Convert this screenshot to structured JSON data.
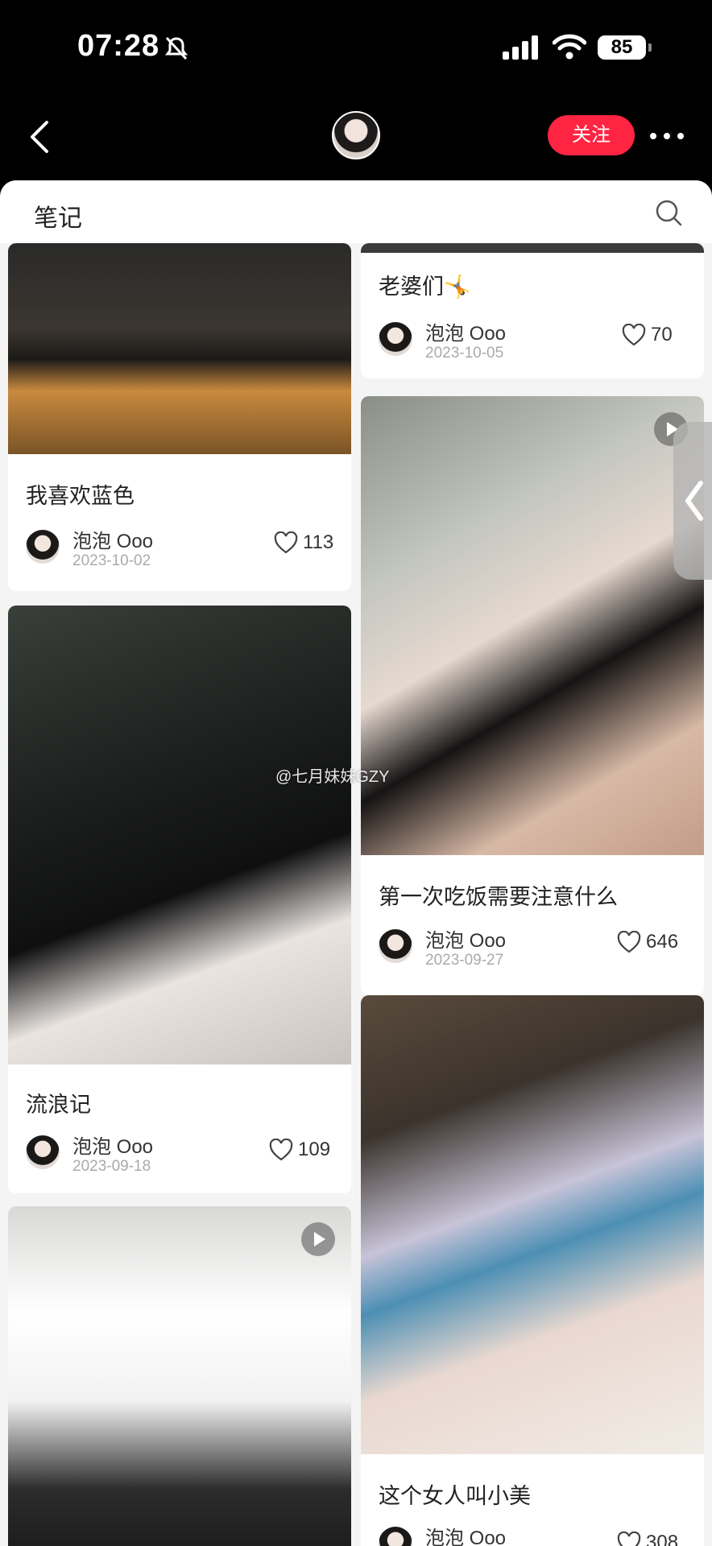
{
  "status_bar": {
    "time": "07:28",
    "battery": "85"
  },
  "nav": {
    "follow_label": "关注"
  },
  "section": {
    "title": "笔记"
  },
  "watermark": "@七月妹妹GZY",
  "notes": [
    {
      "title": "我喜欢蓝色",
      "author": "泡泡 Ooo",
      "date": "2023-10-02",
      "likes": "113"
    },
    {
      "title": "老婆们🤸",
      "author": "泡泡 Ooo",
      "date": "2023-10-05",
      "likes": "70"
    },
    {
      "title": "第一次吃饭需要注意什么",
      "author": "泡泡 Ooo",
      "date": "2023-09-27",
      "likes": "646"
    },
    {
      "title": "流浪记",
      "author": "泡泡 Ooo",
      "date": "2023-09-18",
      "likes": "109"
    },
    {
      "title": "这个女人叫小美",
      "author": "泡泡 Ooo",
      "date": "",
      "likes": "308"
    }
  ]
}
